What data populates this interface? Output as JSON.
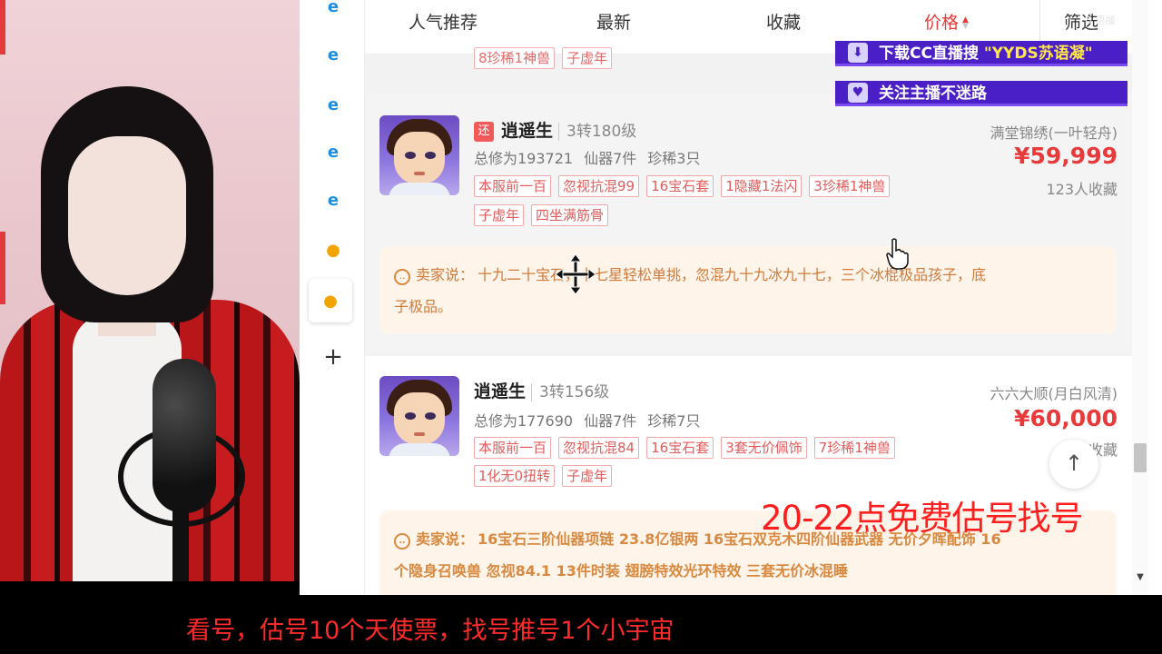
{
  "tabs": [
    {
      "label": "人气推荐"
    },
    {
      "label": "最新"
    },
    {
      "label": "收藏"
    },
    {
      "label": "价格"
    },
    {
      "label": "筛选"
    }
  ],
  "previous_listing_tags": [
    "8珍稀1神兽",
    "子虚年"
  ],
  "listings": [
    {
      "return_badge": "还",
      "name": "逍遥生",
      "level": "3转180级",
      "total_cultivation": "总修为193721",
      "immortal_items": "仙器7件",
      "rare": "珍稀3只",
      "tags_row1": [
        "本服前一百",
        "忽视抗混99",
        "16宝石套",
        "1隐藏1法闪",
        "3珍稀1神兽"
      ],
      "tags_row2": [
        "子虚年",
        "四坐满筋骨"
      ],
      "server": "满堂锦绣(一叶轻舟)",
      "price": "¥59,999",
      "favorites": "123人收藏",
      "seller_label": "卖家说：",
      "seller_line1": "十九二十宝石，十七星轻松单挑，忽混九十九冰九十七，三个冰棍极品孩子，底",
      "seller_line2": "子极品。"
    },
    {
      "name": "逍遥生",
      "level": "3转156级",
      "total_cultivation": "总修为177690",
      "immortal_items": "仙器7件",
      "rare": "珍稀7只",
      "tags_row1": [
        "本服前一百",
        "忽视抗混84",
        "16宝石套",
        "3套无价佩饰",
        "7珍稀1神兽"
      ],
      "tags_row2": [
        "1化无0扭转",
        "子虚年"
      ],
      "server": "六六大顺(月白风清)",
      "price": "¥60,000",
      "favorites": "2 收藏",
      "seller_label": "卖家说：",
      "seller_line1": "16宝石三阶仙器项链 23.8亿银两 16宝石双克木四阶仙器武器 无价夕晖配饰 16",
      "seller_line2": "个隐身召唤兽 忽视84.1 13件时装 翅膀特效光环特效 三套无价冰混睡"
    }
  ],
  "overlays": {
    "download_banner_prefix": "下载CC直播搜",
    "download_banner_highlight": "\"YYDS苏语凝\"",
    "follow_banner": "关注主播不迷路",
    "red_note": "20-22点免费估号找号",
    "bottom_caption": "看号，估号10个天使票，找号推号1个小宇宙",
    "top_watermark": "5 语播"
  },
  "colors": {
    "accent_red": "#e83a3a",
    "banner_purple": "#4b1fc6",
    "banner_highlight": "#ffe84a",
    "seller_orange": "#d8893f"
  },
  "icons": {
    "rail": [
      "ie-icon",
      "ie-icon",
      "ie-icon",
      "ie-icon",
      "ie-icon",
      "chick-icon",
      "chick-icon",
      "plus-icon"
    ],
    "back_to_top": "arrow-up-icon"
  }
}
